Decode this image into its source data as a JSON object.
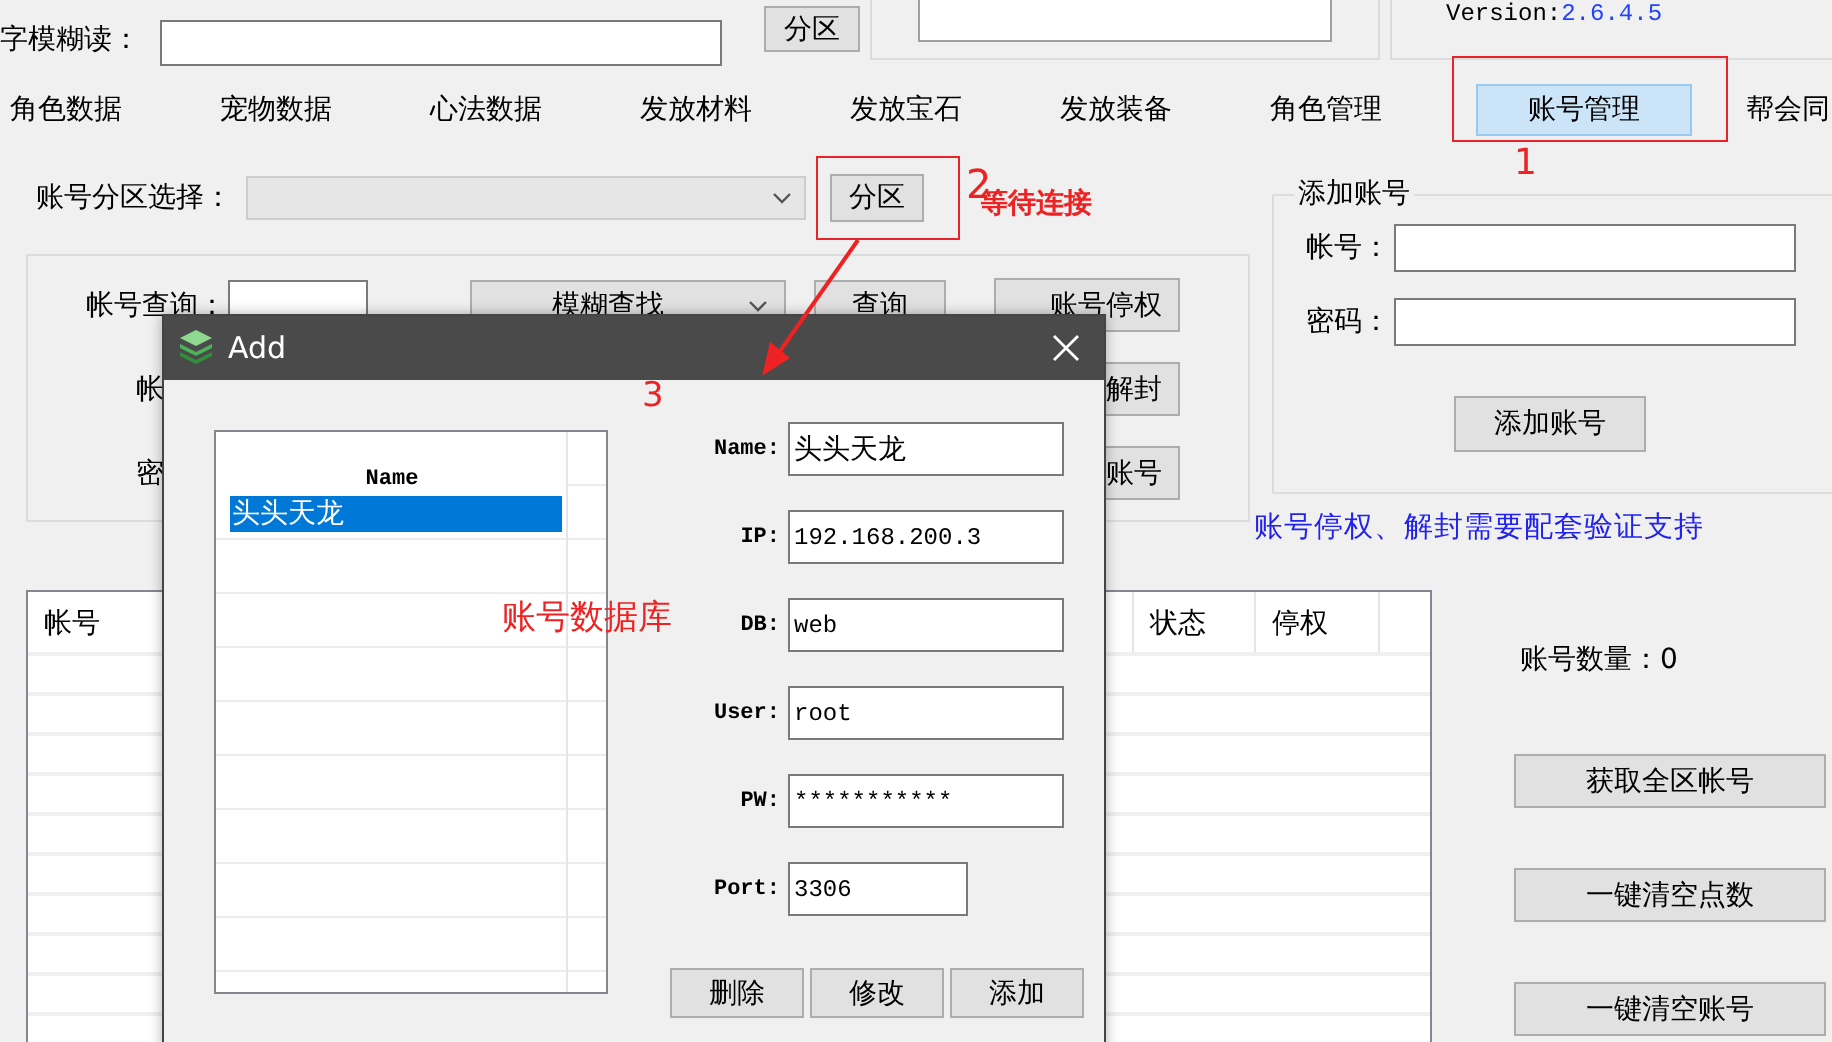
{
  "top": {
    "name_search_label": "字模糊读：",
    "zone_button": "分区",
    "version_label": "Version:",
    "version_value": "2.6.4.5"
  },
  "tabs": [
    {
      "label": "角色数据",
      "selected": false
    },
    {
      "label": "宠物数据",
      "selected": false
    },
    {
      "label": "心法数据",
      "selected": false
    },
    {
      "label": "发放材料",
      "selected": false
    },
    {
      "label": "发放宝石",
      "selected": false
    },
    {
      "label": "发放装备",
      "selected": false
    },
    {
      "label": "角色管理",
      "selected": false
    },
    {
      "label": "账号管理",
      "selected": true
    },
    {
      "label": "帮会同",
      "selected": false
    }
  ],
  "zone": {
    "label": "账号分区选择：",
    "disabled": true,
    "button": "分区"
  },
  "query": {
    "label": "帐号查询：",
    "mode": "模糊查找",
    "button": "查询",
    "row_labels": [
      "帐",
      "密"
    ],
    "buttons": [
      "账号停权",
      "解封",
      "账号"
    ]
  },
  "add_account": {
    "title": "添加账号",
    "fields": [
      {
        "label": "帐号："
      },
      {
        "label": "密码："
      }
    ],
    "button": "添加账号"
  },
  "note": "账号停权、解封需要配套验证支持",
  "table": {
    "columns": [
      "帐号",
      "状态",
      "停权"
    ]
  },
  "count": "账号数量：0",
  "actions": [
    "获取全区帐号",
    "一键清空点数",
    "一键清空账号"
  ],
  "dialog": {
    "title": "Add",
    "list": {
      "column": "Name",
      "rows": [
        {
          "name": "头头天龙",
          "selected": true
        }
      ]
    },
    "fields": [
      {
        "label": "Name:",
        "value": "头头天龙"
      },
      {
        "label": "IP:",
        "value": "192.168.200.3"
      },
      {
        "label": "DB:",
        "value": "web"
      },
      {
        "label": "User:",
        "value": "root"
      },
      {
        "label": "PW:",
        "value": "***********"
      },
      {
        "label": "Port:",
        "value": "3306",
        "kind": "short"
      }
    ],
    "buttons": [
      "删除",
      "修改",
      "添加"
    ]
  },
  "annotations": [
    {
      "kind": "box"
    },
    {
      "kind": "box"
    },
    {
      "kind": "label",
      "text": "1"
    },
    {
      "kind": "label",
      "text": "2"
    },
    {
      "kind": "label",
      "text": "等待连接"
    },
    {
      "kind": "label",
      "text": "3"
    },
    {
      "kind": "arrow"
    },
    {
      "kind": "label",
      "text": "账号数据库"
    }
  ]
}
